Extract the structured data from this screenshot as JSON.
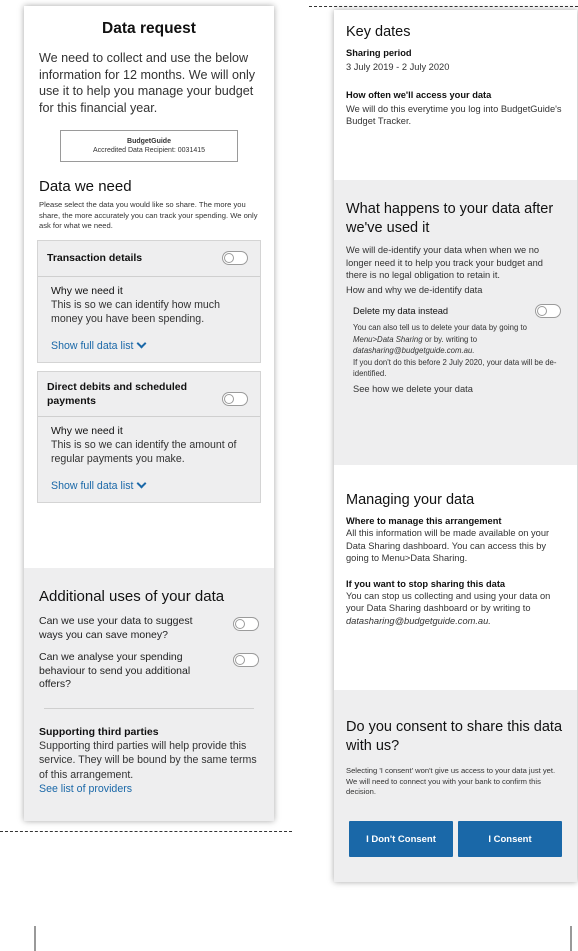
{
  "left": {
    "title": "Data request",
    "intro": "We need to collect and use the below information for 12 months. We will only use it to help you manage your budget for this financial year.",
    "recipient": {
      "name": "BudgetGuide",
      "line": "Accredited Data Recipient: 0031415"
    },
    "data_we_need": {
      "heading": "Data we need",
      "description": "Please select the data you would like so share. The more you share, the more accurately you can track your spending. We only ask for what we need."
    },
    "cards": [
      {
        "title": "Transaction details",
        "why_label": "Why we need it",
        "why_text": "This is so we can identify how much money you have been spending.",
        "link": "Show full data list"
      },
      {
        "title": "Direct debits and scheduled payments",
        "why_label": "Why we need it",
        "why_text": "This is so we can identify the amount of regular payments you make.",
        "link": "Show full data list"
      }
    ],
    "additional": {
      "heading": "Additional uses of your data",
      "q1": "Can we use your data to suggest ways you can save money?",
      "q2": "Can we analyse your spending behaviour to send you additional offers?",
      "third_heading": "Supporting third parties",
      "third_text": "Supporting third parties will help provide this service. They will be bound by the same terms of this arrangement.",
      "third_link": "See list of providers"
    }
  },
  "right": {
    "key_dates": {
      "heading": "Key dates",
      "period_label": "Sharing period",
      "period_value": "3 July 2019 - 2 July 2020",
      "how_label": "How often we'll access your data",
      "how_text": "We will do this everytime you log into BudgetGuide's Budget Tracker."
    },
    "after": {
      "heading": "What happens to your data after we've used it",
      "text": "We will de-identify your data when when we no longer need it to help you track your budget and there is no legal obligation to retain it.",
      "link": "How and why we de-identify data",
      "delete_label": "Delete my data instead",
      "delete_text_1": "You can also tell us to delete your data by going to ",
      "delete_italic_1": "Menu>Data Sharing",
      "delete_text_2": " or by. writing to ",
      "delete_italic_2": "datasharing@budgetguide.com.au.",
      "delete_text_3": "If you don't do this before 2 July 2020, your data will be de-identified.",
      "delete_link": "See how we delete your data"
    },
    "managing": {
      "heading": "Managing your data",
      "where_label": "Where to manage this arrangement",
      "where_text": "All this information will be made available on your Data Sharing dashboard. You can access this by going to Menu>Data Sharing.",
      "stop_label": "If you want to stop sharing this data",
      "stop_text": "You can stop us collecting and using your data on your Data Sharing dashboard or by writing to ",
      "stop_email": "datasharing@budgetguide.com.au."
    },
    "consent": {
      "heading": "Do you consent to share this data with us?",
      "text": "Selecting 'I consent' won't give us access to your data just yet. We will need to connect you with your bank to confirm this decision.",
      "dont_label": "I Don't Consent",
      "consent_label": "I Consent"
    }
  }
}
